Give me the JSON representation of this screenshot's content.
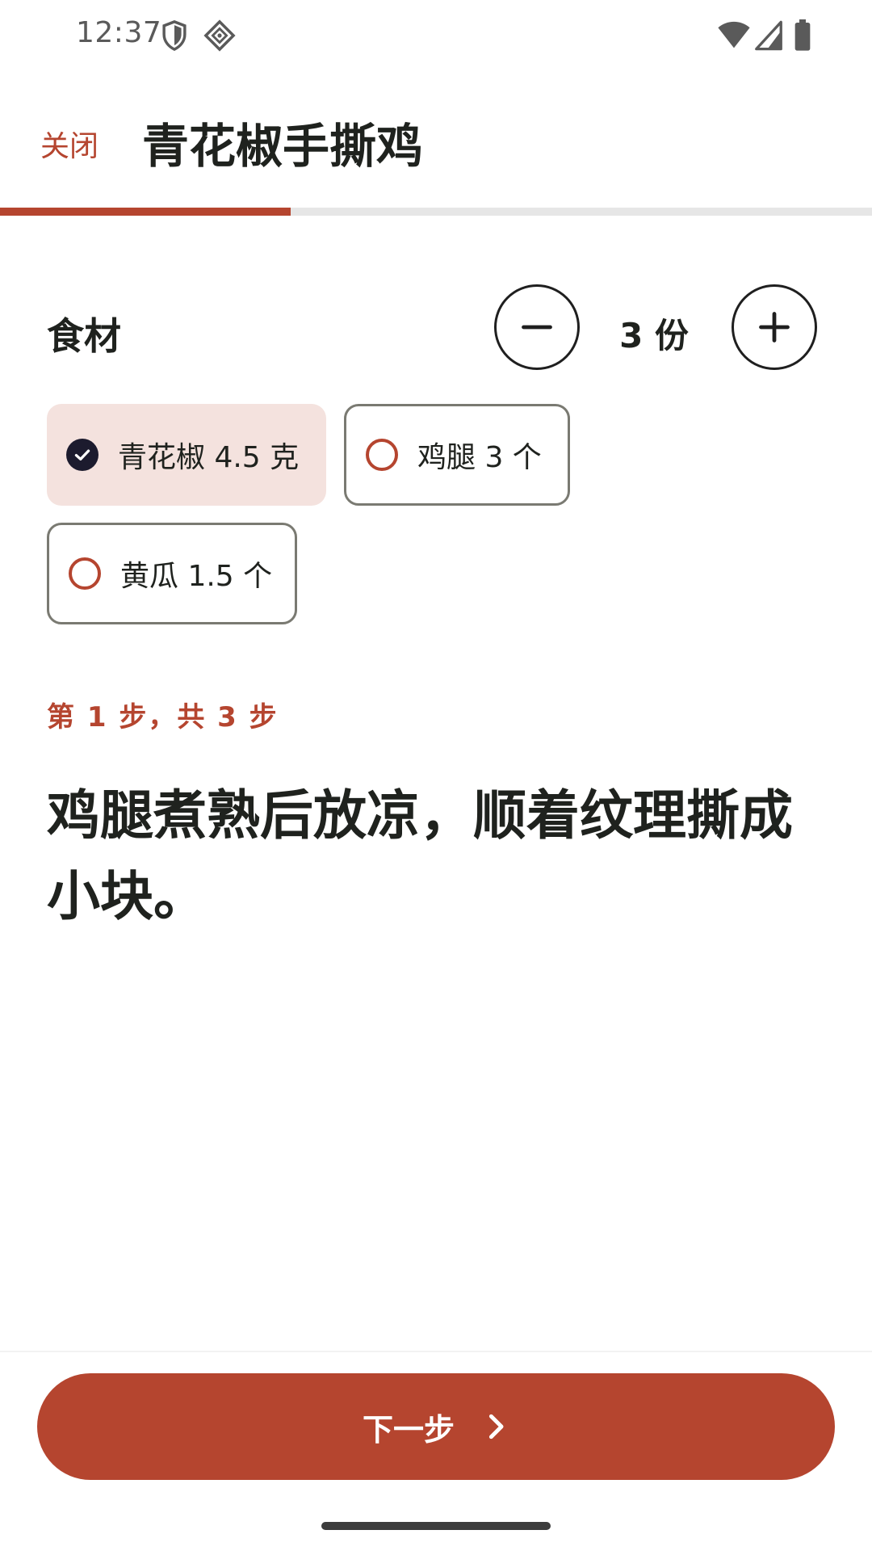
{
  "status_bar": {
    "time": "12:37",
    "icons": [
      "shield-icon",
      "location-diamond-icon",
      "wifi-icon",
      "cell-signal-icon",
      "battery-icon"
    ]
  },
  "header": {
    "close_label": "关闭",
    "title": "青花椒手撕鸡"
  },
  "progress": {
    "fraction": 0.333
  },
  "ingredients": {
    "label": "食材",
    "servings_text": "3 份",
    "items": [
      {
        "label": "青花椒 4.5 克",
        "checked": true
      },
      {
        "label": "鸡腿 3 个",
        "checked": false
      },
      {
        "label": "黄瓜 1.5 个",
        "checked": false
      }
    ]
  },
  "step": {
    "counter": "第 1 步，共 3 步",
    "text": "鸡腿煮熟后放凉，顺着纹理撕成小块。"
  },
  "footer": {
    "next_label": "下一步"
  },
  "colors": {
    "accent": "#b5452f",
    "chip_checked_bg": "#f4e2de",
    "text_primary": "#1f221e"
  }
}
